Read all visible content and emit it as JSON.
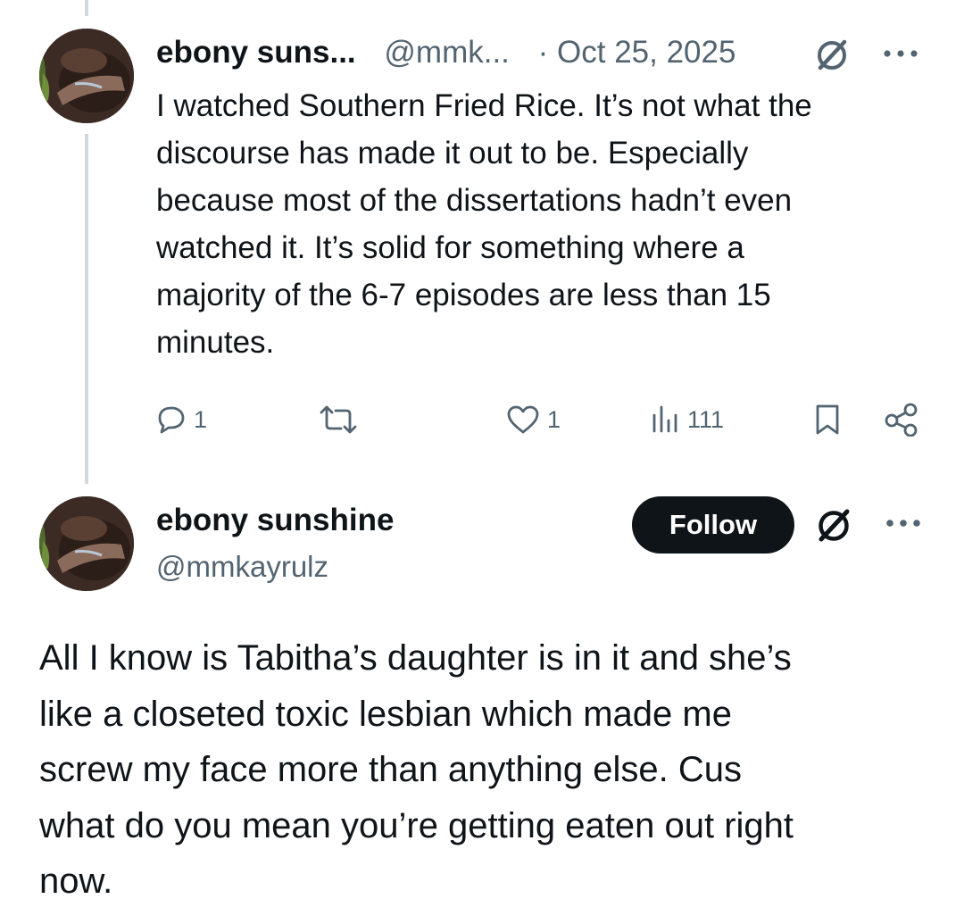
{
  "post1": {
    "author_name": "ebony suns...",
    "handle": "@mmk...",
    "date": "· Oct 25, 2025",
    "text": "I watched Southern Fried Rice. It’s not what the\ndiscourse has made it out to be. Especially\nbecause most of the dissertations hadn’t even\nwatched it. It’s solid for something where a\nmajority of the 6-7 episodes are less than 15\nminutes.",
    "actions": {
      "reply_count": "1",
      "repost_count": "",
      "like_count": "1",
      "views_count": "111"
    }
  },
  "post2": {
    "author_name": "ebony sunshine",
    "handle": "@mmkayrulz",
    "follow_label": "Follow",
    "text": "All I know is Tabitha’s daughter is in it and she’s\nlike a closeted toxic lesbian which made me\nscrew my face more than anything else. Cus\nwhat do you mean you’re getting eaten out right\nnow."
  },
  "icons": {
    "reply": "reply-icon",
    "repost": "repost-icon",
    "like": "heart-icon",
    "views": "views-icon",
    "bookmark": "bookmark-icon",
    "share": "share-icon",
    "grok": "grok-icon",
    "more": "more-icon"
  },
  "colors": {
    "text_primary": "#0f1419",
    "text_secondary": "#536471",
    "thread_line": "#cfd9de",
    "button_bg": "#0f1419",
    "button_text": "#ffffff",
    "background": "#ffffff"
  }
}
